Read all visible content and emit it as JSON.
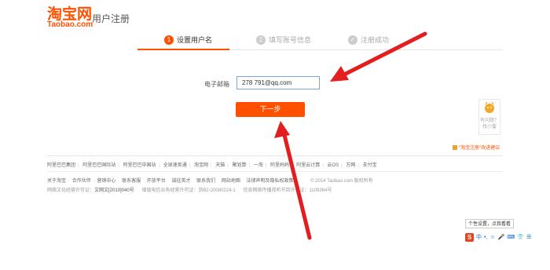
{
  "header": {
    "logo_cn": "淘宝网",
    "logo_en": "Taobao.com",
    "page_title": "用户注册"
  },
  "steps": [
    {
      "num": "1",
      "label": "设置用户名",
      "state": "active"
    },
    {
      "num": "2",
      "label": "填写账号信息",
      "state": "pending"
    },
    {
      "num": "✓",
      "label": "注册成功",
      "state": "pending"
    }
  ],
  "form": {
    "email_label": "电子邮箱",
    "email_value": "278      791@qq.com",
    "next_label": "下一步"
  },
  "help": {
    "text": "有问题？找小蜜",
    "feedback": "\"淘宝注册\"改进建议"
  },
  "footer": {
    "links": [
      "阿里巴巴集团",
      "阿里巴巴国际站",
      "阿里巴巴中国站",
      "全球速卖通",
      "淘宝网",
      "天猫",
      "聚划算",
      "一淘",
      "阿里妈妈",
      "阿里云计算",
      "云OS",
      "万网",
      "支付宝"
    ],
    "links2": [
      "关于淘宝",
      "合作伙伴",
      "营销中心",
      "联系客服",
      "开放平台",
      "诚征英才",
      "联系我们",
      "网站地图",
      "法律声明及隐私权政策"
    ],
    "copyright": "© 2014 Taobao.com 版权所有",
    "legal": [
      "网络文化经营许可证：",
      "文网文[2010]040号",
      "增值电信业务经营许可证：浙B2-20080224-1",
      "信息网络传播视听节目许可证：1109364号"
    ]
  },
  "ime": {
    "tip": "个性设置，点我看看",
    "icons": [
      "S",
      "中",
      "•,",
      "☺",
      "🎤",
      "⌨",
      "👕",
      "☰"
    ]
  },
  "colors": {
    "accent": "#ff5000",
    "arrow": "#e31e1e",
    "input_border": "#7aa7d9"
  }
}
